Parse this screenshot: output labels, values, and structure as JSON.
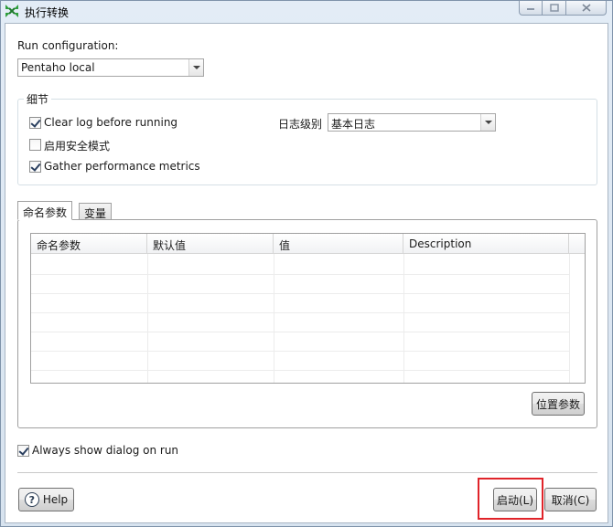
{
  "window": {
    "title": "执行转换"
  },
  "run_config": {
    "label": "Run configuration:",
    "value": "Pentaho local"
  },
  "details": {
    "title": "细节",
    "clear_log": {
      "label": "Clear log before running",
      "checked": true
    },
    "safe_mode": {
      "label": "启用安全模式",
      "checked": false
    },
    "gather_metrics": {
      "label": "Gather performance metrics",
      "checked": true
    },
    "log_level_label": "日志级别",
    "log_level_value": "基本日志"
  },
  "tabs": [
    {
      "label": "命名参数",
      "active": true
    },
    {
      "label": "变量",
      "active": false
    }
  ],
  "params_table": {
    "columns": [
      "命名参数",
      "默认值",
      "值",
      "Description"
    ],
    "rows": []
  },
  "position_params_button": "位置参数",
  "always_show": {
    "label": "Always show dialog on run",
    "checked": true
  },
  "buttons": {
    "help": "Help",
    "start": "启动(L)",
    "cancel": "取消(C)"
  },
  "colors": {
    "highlight": "#e0242a",
    "app_icon": "#2e9e3c"
  }
}
